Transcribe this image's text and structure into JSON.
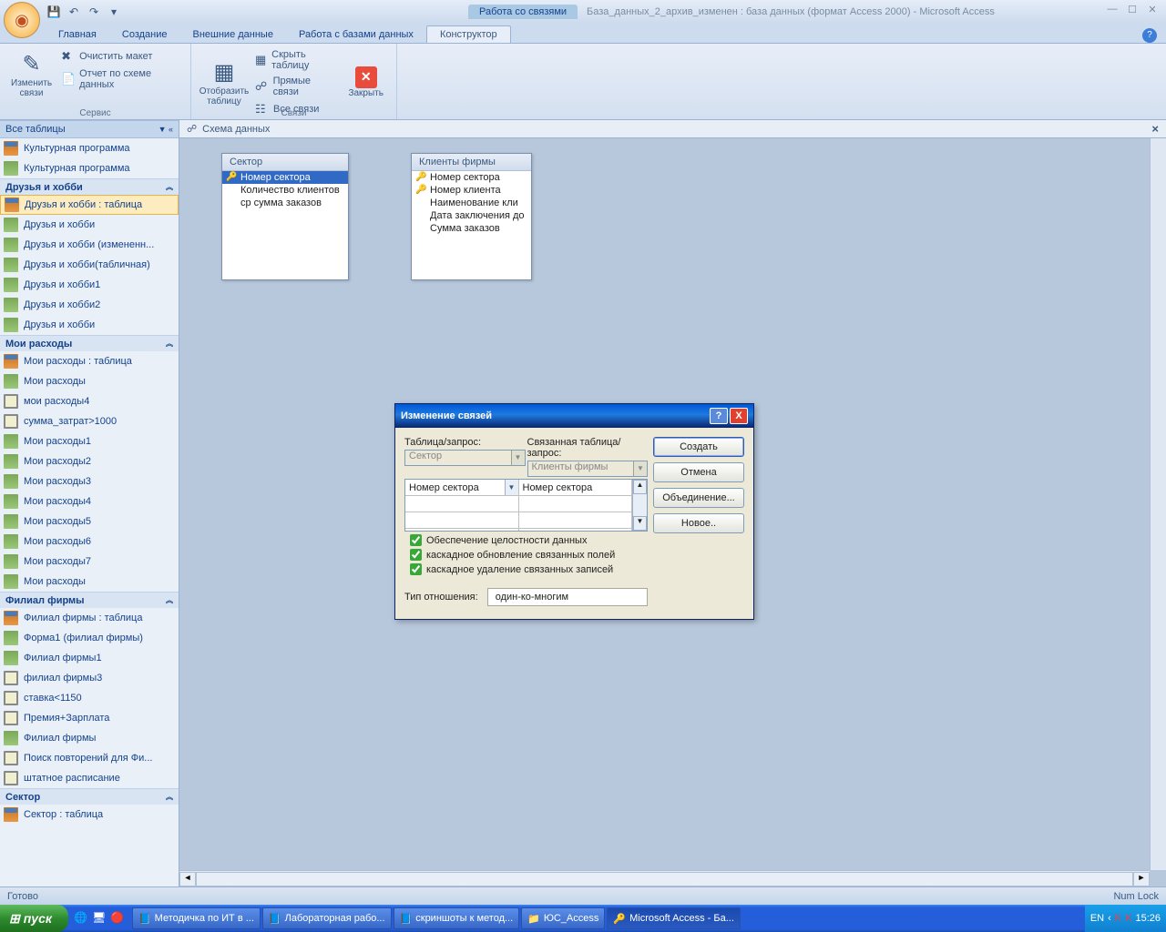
{
  "title_context": "Работа со связями",
  "title_text": "База_данных_2_архив_изменен : база данных (формат Access 2000) - Microsoft Access",
  "tabs": [
    "Главная",
    "Создание",
    "Внешние данные",
    "Работа с базами данных"
  ],
  "tab_ctx": "Конструктор",
  "ribbon": {
    "g1": {
      "btn_big": "Изменить связи",
      "small1": "Очистить макет",
      "small2": "Отчет по схеме данных",
      "label": "Сервис"
    },
    "g2": {
      "btn_big": "Отобразить таблицу",
      "small1": "Скрыть таблицу",
      "small2": "Прямые связи",
      "small3": "Все связи",
      "close": "Закрыть",
      "label": "Связи"
    }
  },
  "nav": {
    "header": "Все таблицы",
    "item_top1": "Культурная программа",
    "item_top2": "Культурная программа",
    "grp1": "Друзья и хобби",
    "g1": [
      "Друзья и хобби : таблица",
      "Друзья и хобби",
      "Друзья и хобби (измененн...",
      "Друзья и хобби(табличная)",
      "Друзья и хобби1",
      "Друзья и хобби2",
      "Друзья и хобби"
    ],
    "grp2": "Мои расходы",
    "g2": [
      "Мои расходы : таблица",
      "Мои расходы",
      "мои расходы4",
      "сумма_затрат>1000",
      "Мои расходы1",
      "Мои расходы2",
      "Мои расходы3",
      "Мои расходы4",
      "Мои расходы5",
      "Мои расходы6",
      "Мои расходы7",
      "Мои расходы"
    ],
    "grp3": "Филиал фирмы",
    "g3": [
      "Филиал фирмы : таблица",
      "Форма1 (филиал фирмы)",
      "Филиал фирмы1",
      "филиал фирмы3",
      "ставка<1150",
      "Премия+Зарплата",
      "Филиал фирмы",
      "Поиск повторений для Фи...",
      "штатное расписание"
    ],
    "grp4": "Сектор",
    "g4": [
      "Сектор : таблица"
    ]
  },
  "ws_title": "Схема данных",
  "table1": {
    "title": "Сектор",
    "rows": [
      "Номер сектора",
      "Количество клиентов",
      "ср сумма заказов"
    ]
  },
  "table2": {
    "title": "Клиенты фирмы",
    "rows": [
      "Номер сектора",
      "Номер клиента",
      "Наименование кли",
      "Дата заключения до",
      "Сумма заказов"
    ]
  },
  "dialog": {
    "title": "Изменение связей",
    "lbl_table": "Таблица/запрос:",
    "lbl_related": "Связанная таблица/запрос:",
    "sel1": "Сектор",
    "sel2": "Клиенты фирмы",
    "field1": "Номер сектора",
    "field2": "Номер сектора",
    "chk1": "Обеспечение целостности данных",
    "chk2": "каскадное обновление связанных полей",
    "chk3": "каскадное удаление связанных записей",
    "type_lbl": "Тип отношения:",
    "type_val": "один-ко-многим",
    "btn_create": "Создать",
    "btn_cancel": "Отмена",
    "btn_join": "Объединение...",
    "btn_new": "Новое.."
  },
  "status": {
    "left": "Готово",
    "right": "Num Lock"
  },
  "taskbar": {
    "start": "пуск",
    "items": [
      "Методичка по ИТ в ...",
      "Лабораторная рабо...",
      "скриншоты к метод...",
      "ЮС_Access",
      "Microsoft Access - Ба..."
    ],
    "lang": "EN",
    "time": "15:26"
  }
}
